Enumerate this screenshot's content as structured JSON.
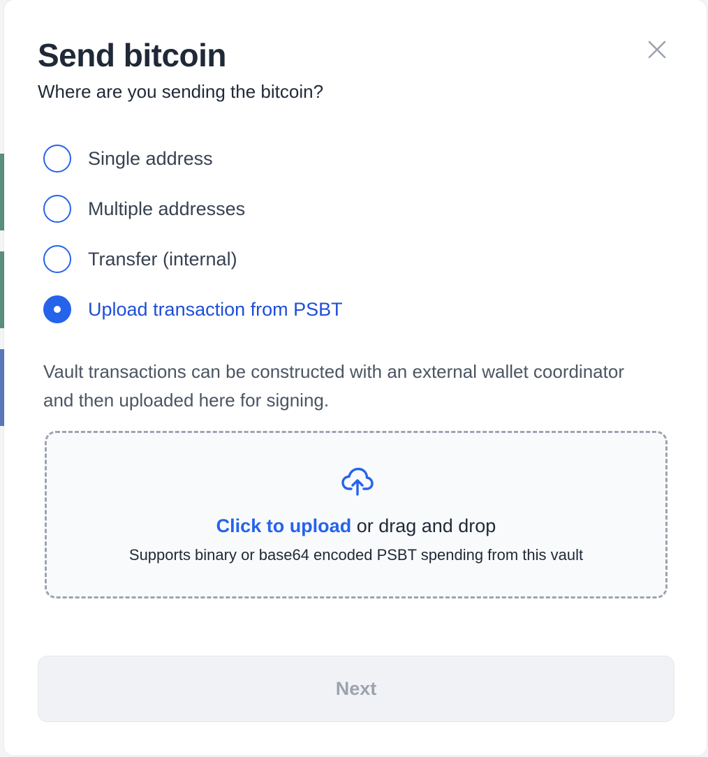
{
  "dialog": {
    "title": "Send bitcoin",
    "subtitle": "Where are you sending the bitcoin?",
    "close_icon": "close-icon"
  },
  "options": [
    {
      "label": "Single address",
      "checked": false
    },
    {
      "label": "Multiple addresses",
      "checked": false
    },
    {
      "label": "Transfer (internal)",
      "checked": false
    },
    {
      "label": "Upload transaction from PSBT",
      "checked": true
    }
  ],
  "description": "Vault transactions can be constructed with an external wallet coordinator and then uploaded here for signing.",
  "dropzone": {
    "icon": "cloud-upload-icon",
    "link_text": "Click to upload",
    "rest_text": " or drag and drop",
    "hint": "Supports binary or base64 encoded PSBT spending from this vault"
  },
  "footer": {
    "next_label": "Next",
    "next_disabled": true
  },
  "colors": {
    "accent": "#2563eb",
    "text": "#1f2937",
    "muted": "#9ca3af"
  }
}
